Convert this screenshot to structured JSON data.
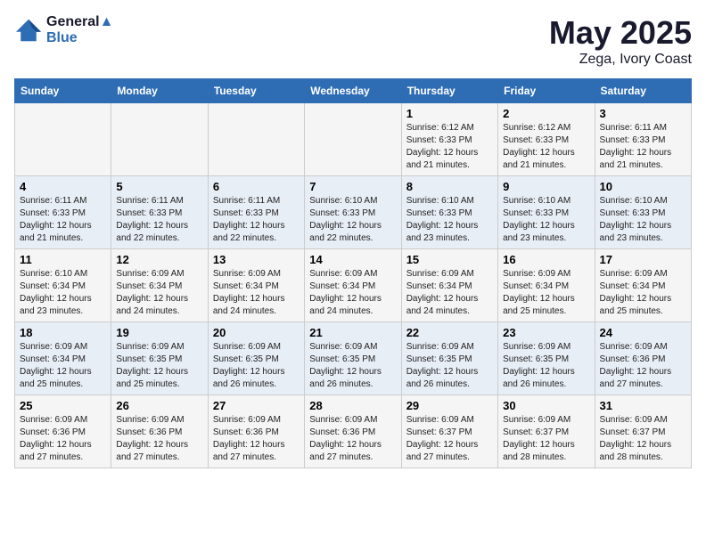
{
  "logo": {
    "line1": "General",
    "line2": "Blue"
  },
  "title": "May 2025",
  "subtitle": "Zega, Ivory Coast",
  "days_header": [
    "Sunday",
    "Monday",
    "Tuesday",
    "Wednesday",
    "Thursday",
    "Friday",
    "Saturday"
  ],
  "weeks": [
    [
      {
        "day": "",
        "info": ""
      },
      {
        "day": "",
        "info": ""
      },
      {
        "day": "",
        "info": ""
      },
      {
        "day": "",
        "info": ""
      },
      {
        "day": "1",
        "info": "Sunrise: 6:12 AM\nSunset: 6:33 PM\nDaylight: 12 hours\nand 21 minutes."
      },
      {
        "day": "2",
        "info": "Sunrise: 6:12 AM\nSunset: 6:33 PM\nDaylight: 12 hours\nand 21 minutes."
      },
      {
        "day": "3",
        "info": "Sunrise: 6:11 AM\nSunset: 6:33 PM\nDaylight: 12 hours\nand 21 minutes."
      }
    ],
    [
      {
        "day": "4",
        "info": "Sunrise: 6:11 AM\nSunset: 6:33 PM\nDaylight: 12 hours\nand 21 minutes."
      },
      {
        "day": "5",
        "info": "Sunrise: 6:11 AM\nSunset: 6:33 PM\nDaylight: 12 hours\nand 22 minutes."
      },
      {
        "day": "6",
        "info": "Sunrise: 6:11 AM\nSunset: 6:33 PM\nDaylight: 12 hours\nand 22 minutes."
      },
      {
        "day": "7",
        "info": "Sunrise: 6:10 AM\nSunset: 6:33 PM\nDaylight: 12 hours\nand 22 minutes."
      },
      {
        "day": "8",
        "info": "Sunrise: 6:10 AM\nSunset: 6:33 PM\nDaylight: 12 hours\nand 23 minutes."
      },
      {
        "day": "9",
        "info": "Sunrise: 6:10 AM\nSunset: 6:33 PM\nDaylight: 12 hours\nand 23 minutes."
      },
      {
        "day": "10",
        "info": "Sunrise: 6:10 AM\nSunset: 6:33 PM\nDaylight: 12 hours\nand 23 minutes."
      }
    ],
    [
      {
        "day": "11",
        "info": "Sunrise: 6:10 AM\nSunset: 6:34 PM\nDaylight: 12 hours\nand 23 minutes."
      },
      {
        "day": "12",
        "info": "Sunrise: 6:09 AM\nSunset: 6:34 PM\nDaylight: 12 hours\nand 24 minutes."
      },
      {
        "day": "13",
        "info": "Sunrise: 6:09 AM\nSunset: 6:34 PM\nDaylight: 12 hours\nand 24 minutes."
      },
      {
        "day": "14",
        "info": "Sunrise: 6:09 AM\nSunset: 6:34 PM\nDaylight: 12 hours\nand 24 minutes."
      },
      {
        "day": "15",
        "info": "Sunrise: 6:09 AM\nSunset: 6:34 PM\nDaylight: 12 hours\nand 24 minutes."
      },
      {
        "day": "16",
        "info": "Sunrise: 6:09 AM\nSunset: 6:34 PM\nDaylight: 12 hours\nand 25 minutes."
      },
      {
        "day": "17",
        "info": "Sunrise: 6:09 AM\nSunset: 6:34 PM\nDaylight: 12 hours\nand 25 minutes."
      }
    ],
    [
      {
        "day": "18",
        "info": "Sunrise: 6:09 AM\nSunset: 6:34 PM\nDaylight: 12 hours\nand 25 minutes."
      },
      {
        "day": "19",
        "info": "Sunrise: 6:09 AM\nSunset: 6:35 PM\nDaylight: 12 hours\nand 25 minutes."
      },
      {
        "day": "20",
        "info": "Sunrise: 6:09 AM\nSunset: 6:35 PM\nDaylight: 12 hours\nand 26 minutes."
      },
      {
        "day": "21",
        "info": "Sunrise: 6:09 AM\nSunset: 6:35 PM\nDaylight: 12 hours\nand 26 minutes."
      },
      {
        "day": "22",
        "info": "Sunrise: 6:09 AM\nSunset: 6:35 PM\nDaylight: 12 hours\nand 26 minutes."
      },
      {
        "day": "23",
        "info": "Sunrise: 6:09 AM\nSunset: 6:35 PM\nDaylight: 12 hours\nand 26 minutes."
      },
      {
        "day": "24",
        "info": "Sunrise: 6:09 AM\nSunset: 6:36 PM\nDaylight: 12 hours\nand 27 minutes."
      }
    ],
    [
      {
        "day": "25",
        "info": "Sunrise: 6:09 AM\nSunset: 6:36 PM\nDaylight: 12 hours\nand 27 minutes."
      },
      {
        "day": "26",
        "info": "Sunrise: 6:09 AM\nSunset: 6:36 PM\nDaylight: 12 hours\nand 27 minutes."
      },
      {
        "day": "27",
        "info": "Sunrise: 6:09 AM\nSunset: 6:36 PM\nDaylight: 12 hours\nand 27 minutes."
      },
      {
        "day": "28",
        "info": "Sunrise: 6:09 AM\nSunset: 6:36 PM\nDaylight: 12 hours\nand 27 minutes."
      },
      {
        "day": "29",
        "info": "Sunrise: 6:09 AM\nSunset: 6:37 PM\nDaylight: 12 hours\nand 27 minutes."
      },
      {
        "day": "30",
        "info": "Sunrise: 6:09 AM\nSunset: 6:37 PM\nDaylight: 12 hours\nand 28 minutes."
      },
      {
        "day": "31",
        "info": "Sunrise: 6:09 AM\nSunset: 6:37 PM\nDaylight: 12 hours\nand 28 minutes."
      }
    ]
  ]
}
